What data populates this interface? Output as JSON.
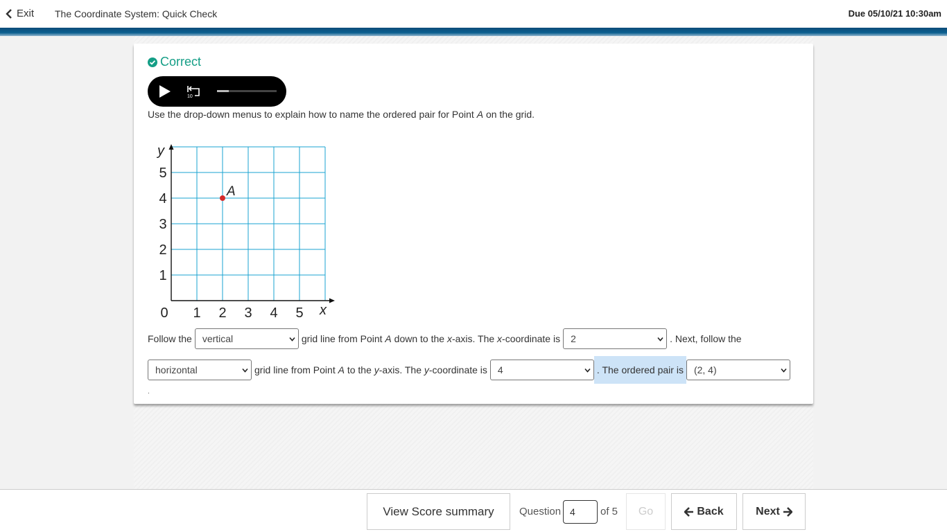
{
  "header": {
    "exit_label": "Exit",
    "title": "The Coordinate System: Quick Check",
    "due": "Due 05/10/21 10:30am"
  },
  "status": {
    "label": "Correct",
    "color": "#149e86"
  },
  "player": {
    "rewind_label": "10",
    "progress": 0.2
  },
  "instruction": {
    "before": "Use the drop-down menus to explain how to name the ordered pair for Point ",
    "point": "A",
    "after": " on the grid."
  },
  "graph": {
    "x_ticks": [
      "0",
      "1",
      "2",
      "3",
      "4",
      "5"
    ],
    "y_ticks": [
      "1",
      "2",
      "3",
      "4",
      "5"
    ],
    "x_label": "x",
    "y_label": "y",
    "point_label": "A",
    "point": [
      2,
      4
    ],
    "grid_color": "#1aa3d0",
    "point_color": "#d42a2a"
  },
  "sentence": {
    "s1": "Follow the",
    "dd1": "vertical",
    "s2": "grid line from Point",
    "s2_point": "A",
    "s3": "down to the",
    "s3_x": "x",
    "s4": "-axis. The",
    "s4_x": "x",
    "s5": "-coordinate is",
    "dd2": "2",
    "s6": ". Next, follow the",
    "dd3": "horizontal",
    "s7": "grid line from Point",
    "s7_point": "A",
    "s8": "to the",
    "s8_y": "y",
    "s9": "-axis. The",
    "s9_y": "y",
    "s10": "-coordinate is",
    "dd4": "4",
    "s11": ". The ordered pair is",
    "dd5": "(2, 4)",
    "trailing": "."
  },
  "footer": {
    "score_summary": "View Score summary",
    "question_label": "Question",
    "question_value": "4",
    "of_label": "of 5",
    "go": "Go",
    "back": "Back",
    "next": "Next"
  }
}
